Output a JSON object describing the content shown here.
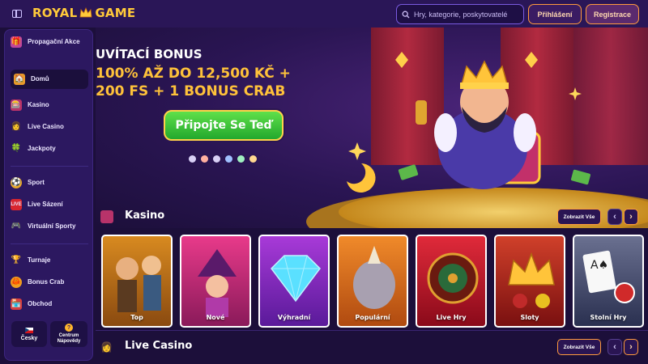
{
  "header": {
    "logo_left": "ROYAL",
    "logo_right": "GAME",
    "search_placeholder": "Hry, kategorie, poskytovatelé",
    "login_label": "Přihlášení",
    "register_label": "Registrace"
  },
  "sidebar": {
    "items": [
      {
        "label": "Propagační Akce",
        "icon": "gift-icon"
      },
      {
        "label": "Domů",
        "icon": "home-icon",
        "active": true
      },
      {
        "label": "Kasino",
        "icon": "slot-machine-icon"
      },
      {
        "label": "Live Casino",
        "icon": "dealer-icon"
      },
      {
        "label": "Jackpoty",
        "icon": "clover-icon"
      },
      {
        "label": "Sport",
        "icon": "ball-icon"
      },
      {
        "label": "Live Sázení",
        "icon": "live-icon"
      },
      {
        "label": "Virtuální Sporty",
        "icon": "gamepad-icon"
      },
      {
        "label": "Turnaje",
        "icon": "trophy-icon"
      },
      {
        "label": "Bonus Crab",
        "icon": "crab-icon"
      },
      {
        "label": "Obchod",
        "icon": "shop-icon"
      }
    ],
    "language_label": "Česky",
    "help_label": "Centrum Nápovědy"
  },
  "hero": {
    "title": "UVÍTACÍ BONUS",
    "line1": "100% AŽ DO 12,500 KČ +",
    "line2": "200 FS + 1 BONUS CRAB",
    "cta_label": "Připojte Se Teď"
  },
  "sections": {
    "kasino": {
      "title": "Kasino",
      "show_all": "Zobrazit Vše",
      "cards": [
        {
          "label": "Top"
        },
        {
          "label": "Nové"
        },
        {
          "label": "Výhradní"
        },
        {
          "label": "Populární"
        },
        {
          "label": "Live Hry"
        },
        {
          "label": "Sloty"
        },
        {
          "label": "Stolní Hry"
        }
      ]
    },
    "live_casino": {
      "title": "Live Casino",
      "show_all": "Zobrazit Vše"
    }
  },
  "colors": {
    "accent_orange": "#ff9a3d",
    "gold": "#ffc23a",
    "cta_green": "#3cc63a",
    "background": "#1c0f3a"
  }
}
